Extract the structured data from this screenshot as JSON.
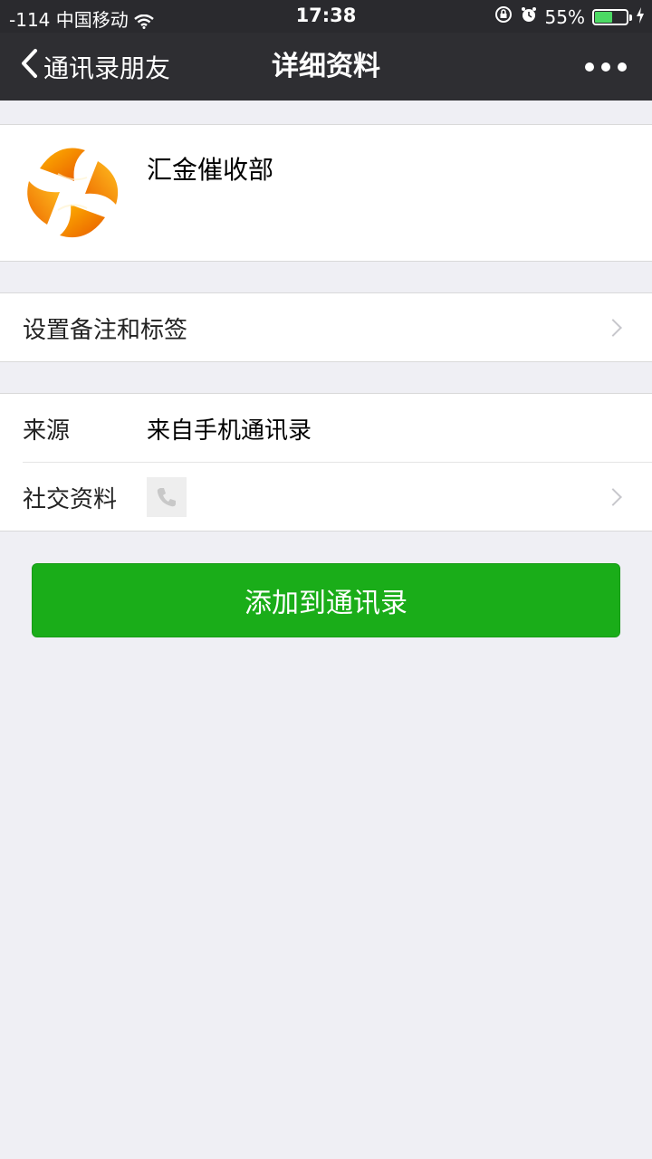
{
  "status_bar": {
    "carrier": "-114 中国移动",
    "time": "17:38",
    "battery_percent": "55%",
    "battery_level": 0.55,
    "icons": [
      "wifi-icon",
      "rotation-lock-icon",
      "alarm-icon",
      "battery-icon",
      "charging-icon"
    ]
  },
  "nav": {
    "back_label": "通讯录朋友",
    "title": "详细资料",
    "more_icon": "ellipsis-icon"
  },
  "profile": {
    "name": "汇金催收部",
    "avatar_icon": "orange-logo-avatar"
  },
  "remark_row": {
    "label": "设置备注和标签"
  },
  "info": {
    "source_label": "来源",
    "source_value": "来自手机通讯录",
    "social_label": "社交资料",
    "social_icon": "phone-icon"
  },
  "actions": {
    "add_button": "添加到通讯录"
  },
  "colors": {
    "nav_bg": "#2e2e32",
    "button_green": "#1aad19",
    "page_bg": "#efeff4"
  }
}
